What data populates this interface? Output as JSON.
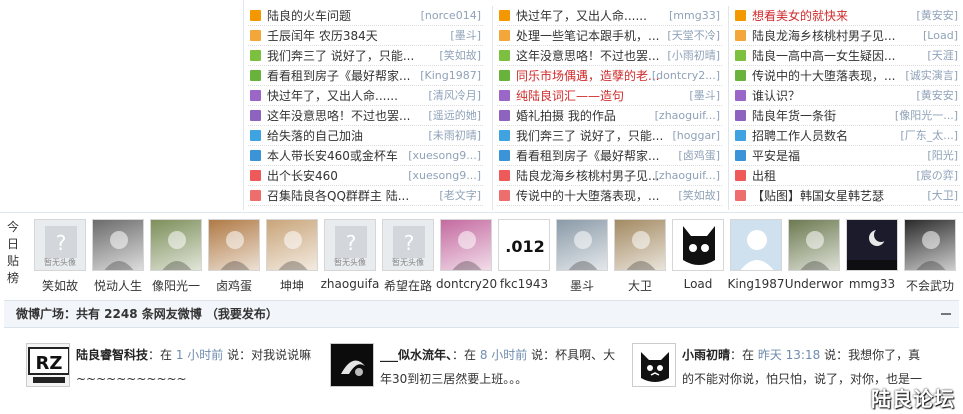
{
  "ranking": {
    "columns": [
      [
        {
          "title": "陆良的火车问题",
          "author": "[norce014]",
          "red": false
        },
        {
          "title": "壬辰闰年 农历384天",
          "author": "[墨斗]",
          "red": false
        },
        {
          "title": "我们奔三了 说好了，只能...",
          "author": "[笑如故]",
          "red": false
        },
        {
          "title": "看看租到房子《最好帮家...",
          "author": "[King1987]",
          "red": false
        },
        {
          "title": "快过年了，又出人命......",
          "author": "[清风冷月]",
          "red": false
        },
        {
          "title": "这年没意思咯！不过也罢...",
          "author": "[遥远的她]",
          "red": false
        },
        {
          "title": "给失落的自己加油",
          "author": "[未雨初晴]",
          "red": false
        },
        {
          "title": "本人带长安460或金杯车",
          "author": "[xuesong9...]",
          "red": false
        },
        {
          "title": "出个长安460",
          "author": "[xuesong9...]",
          "red": false
        },
        {
          "title": "召集陆良各QQ群群主 陆...",
          "author": "[老文字]",
          "red": false
        }
      ],
      [
        {
          "title": "快过年了，又出人命......",
          "author": "[mmg33]",
          "red": false
        },
        {
          "title": "处理一些笔记本跟手机，...",
          "author": "[天堂不冷]",
          "red": false
        },
        {
          "title": "这年没意思咯！不过也罢...",
          "author": "[小雨初晴]",
          "red": false
        },
        {
          "title": "同乐市场偶遇，造孽的老...",
          "author": "[dontcry2...]",
          "red": true
        },
        {
          "title": "纯陆良词汇——造句",
          "author": "[墨斗]",
          "red": true
        },
        {
          "title": "婚礼拍摄 我的作品",
          "author": "[zhaoguif...]",
          "red": false
        },
        {
          "title": "我们奔三了 说好了，只能...",
          "author": "[hoggar]",
          "red": false
        },
        {
          "title": "看看租到房子《最好帮家...",
          "author": "[卤鸡蛋]",
          "red": false
        },
        {
          "title": "陆良龙海乡核桃村男子见...",
          "author": "[zhaoguif...]",
          "red": false
        },
        {
          "title": "传说中的十大堕落表现，...",
          "author": "[笑如故]",
          "red": false
        }
      ],
      [
        {
          "title": "想看美女的就快来",
          "author": "[黄安安]",
          "red": true
        },
        {
          "title": "陆良龙海乡核桃村男子见...",
          "author": "[Load]",
          "red": false
        },
        {
          "title": "陆良一高中高一女生疑因...",
          "author": "[天涯]",
          "red": false
        },
        {
          "title": "传说中的十大堕落表现，...",
          "author": "[诚实演言]",
          "red": false
        },
        {
          "title": "谁认识？",
          "author": "[黄安安]",
          "red": false
        },
        {
          "title": "陆良年货一条街",
          "author": "[像阳光一...]",
          "red": false
        },
        {
          "title": "招聘工作人员数名",
          "author": "[厂东_太...]",
          "red": false
        },
        {
          "title": "平安是福",
          "author": "[阳光]",
          "red": false
        },
        {
          "title": "出租",
          "author": "[宸の弈]",
          "red": false
        },
        {
          "title": "【贴图】韩国女星韩艺瑟",
          "author": "[大卫]",
          "red": false
        }
      ]
    ]
  },
  "posters": {
    "label": "今日贴榜",
    "items": [
      {
        "name": "笑如故",
        "avatar": "no-avatar"
      },
      {
        "name": "悦动人生",
        "avatar": "headphone-photo"
      },
      {
        "name": "像阳光一",
        "avatar": "photo"
      },
      {
        "name": "卤鸡蛋",
        "avatar": "photo"
      },
      {
        "name": "坤坤",
        "avatar": "bear-photo"
      },
      {
        "name": "zhaoguifa",
        "avatar": "no-avatar"
      },
      {
        "name": "希望在路",
        "avatar": "no-avatar"
      },
      {
        "name": "dontcry20",
        "avatar": "photo"
      },
      {
        "name": "fkc1943",
        "avatar": "text-graphic"
      },
      {
        "name": "墨斗",
        "avatar": "photo"
      },
      {
        "name": "大卫",
        "avatar": "photo"
      },
      {
        "name": "Load",
        "avatar": "cartoon-cat"
      },
      {
        "name": "King1987",
        "avatar": "default-silhouette"
      },
      {
        "name": "Underwor",
        "avatar": "photo"
      },
      {
        "name": "mmg33",
        "avatar": "moon-photo"
      },
      {
        "name": "不会武功",
        "avatar": "dark-photo"
      }
    ],
    "no_avatar_text": "暂无头像"
  },
  "weibo": {
    "header": "微博广场：共有 2248 条网友微博 （我要发布）",
    "feeds": [
      {
        "name": "陆良睿智科技",
        "at": "：在 ",
        "time": "1 小时前",
        "said": " 说：",
        "text": "对我说说嘛~~~~~~~~~~~",
        "avatar_text": "RZ"
      },
      {
        "name": "___似水流年、",
        "at": "：在 ",
        "time": "8 小时前",
        "said": " 说：",
        "text": "杯具啊、大年30到初三居然要上班。。。",
        "avatar_text": ""
      },
      {
        "name": "小雨初晴",
        "at": "：在 ",
        "time": "昨天 13:18",
        "said": " 说：",
        "text": "我想你了，真的不能对你说，怕只怕，说了，对你，也是一",
        "avatar_text": ""
      }
    ]
  },
  "brand": "陆良论坛",
  "colors": {
    "accent_red": "#d02b2b",
    "author": "#8fa2b8",
    "time": "#6f8cae"
  }
}
